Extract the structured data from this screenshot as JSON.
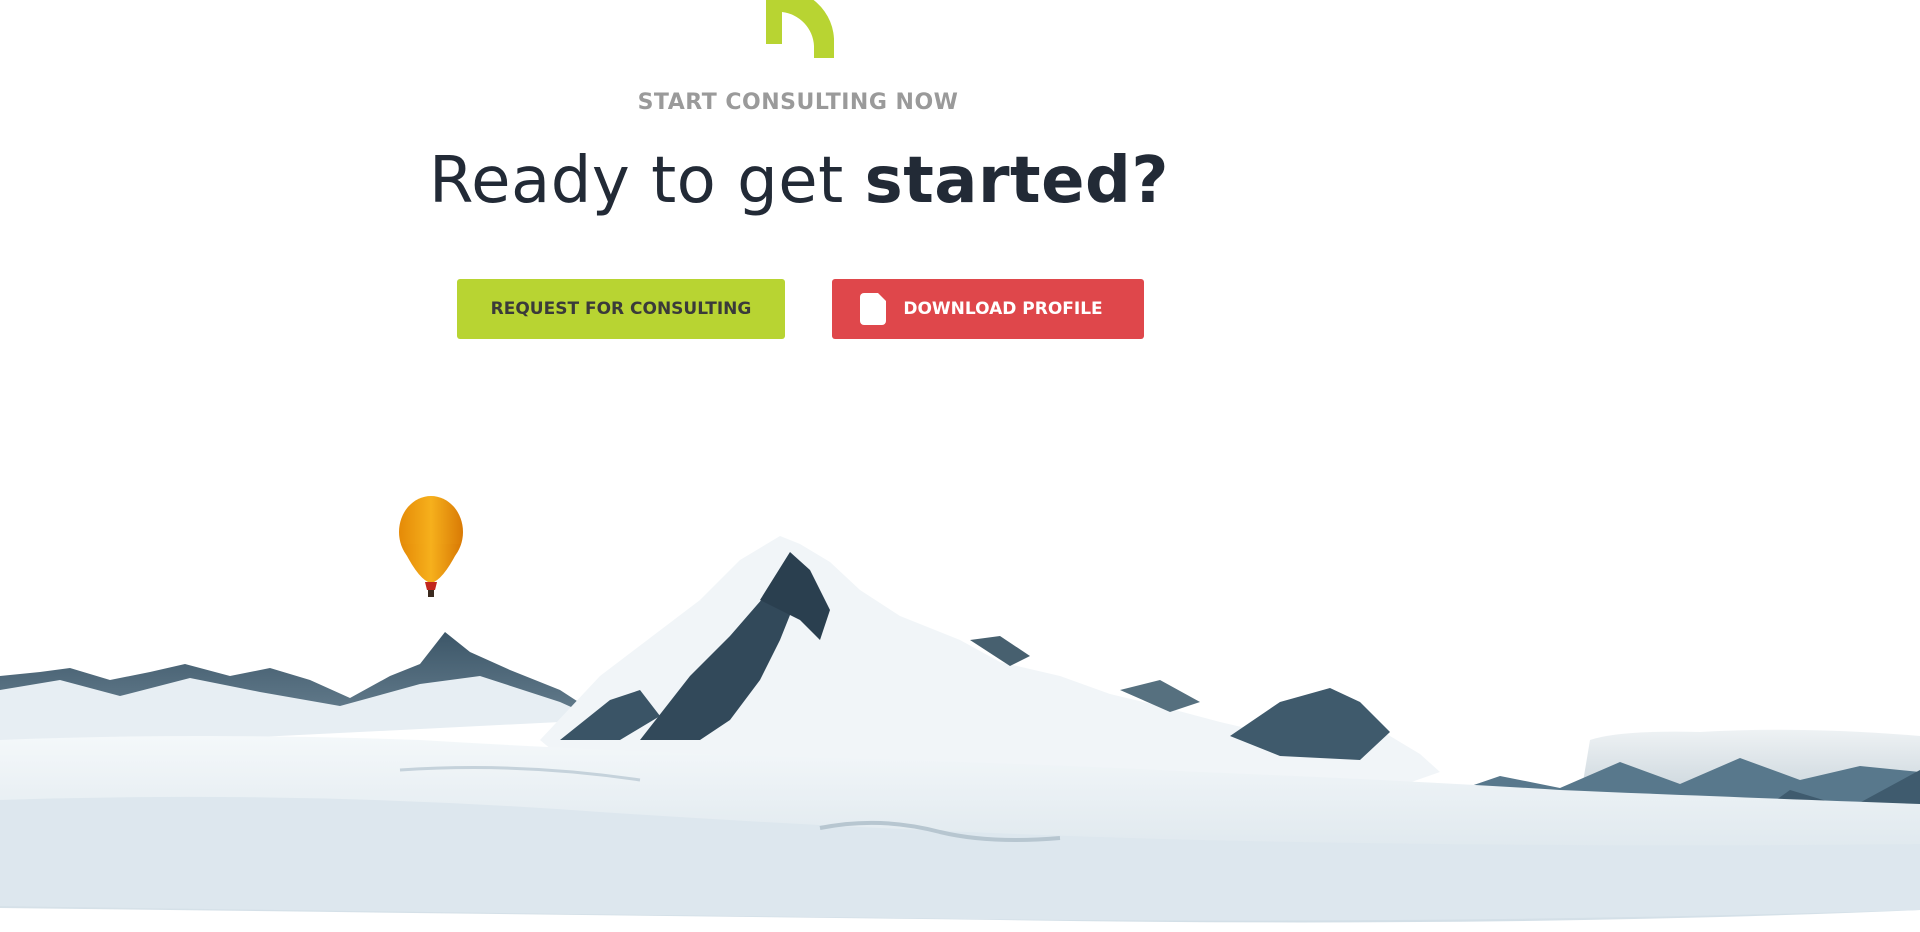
{
  "hero": {
    "kicker": "START CONSULTING NOW",
    "headline_regular": "Ready to get ",
    "headline_bold": "started?"
  },
  "buttons": {
    "consult_label": "REQUEST FOR CONSULTING",
    "download_label": "DOWNLOAD PROFILE",
    "download_icon": "file-icon"
  },
  "illustration": {
    "subject": "snowy-mountains",
    "balloon_icon": "hot-air-balloon"
  },
  "colors": {
    "accent_green": "#b8d432",
    "accent_red": "#df474b",
    "heading": "#222a36",
    "kicker": "#9a9a9a"
  }
}
